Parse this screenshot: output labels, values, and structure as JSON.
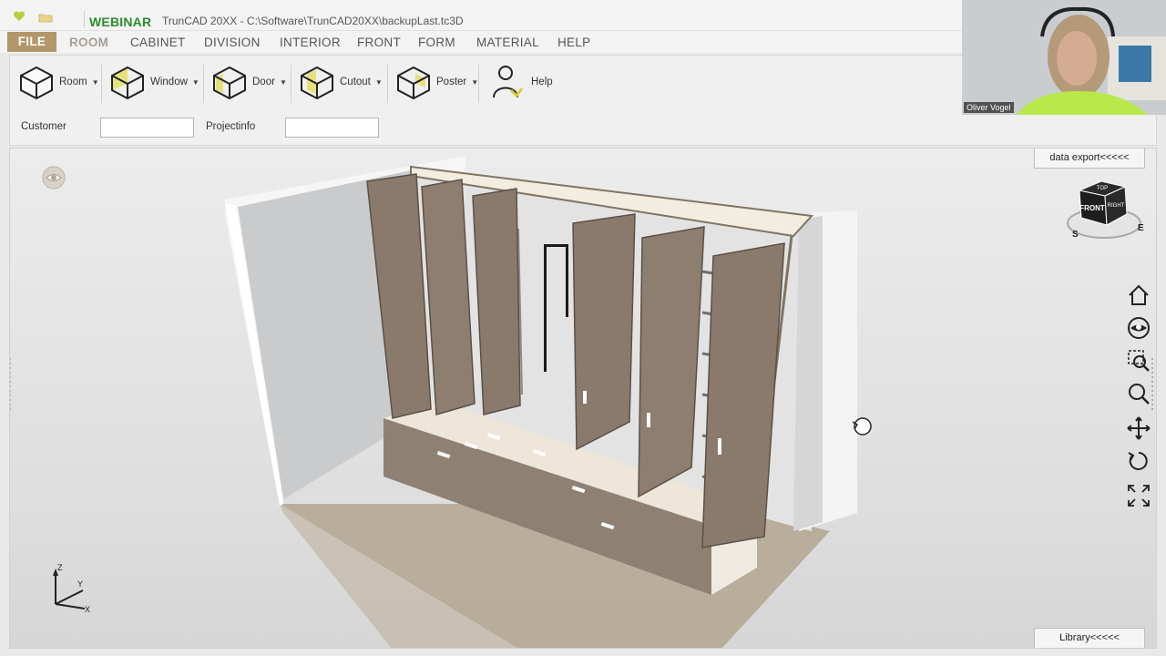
{
  "app": {
    "brand": "WEBINAR",
    "window_title": "TrunCAD 20XX - C:\\Software\\TrunCAD20XX\\backupLast.tc3D"
  },
  "menu": {
    "items": [
      "FILE",
      "ROOM",
      "CABINET",
      "DIVISION",
      "INTERIOR",
      "FRONT",
      "FORM",
      "MATERIAL",
      "HELP"
    ],
    "active": "ROOM"
  },
  "ribbon": {
    "buttons": [
      {
        "label": "Room",
        "icon": "room-icon",
        "dropdown": true
      },
      {
        "label": "Window",
        "icon": "window-icon",
        "dropdown": true
      },
      {
        "label": "Door",
        "icon": "door-icon",
        "dropdown": true
      },
      {
        "label": "Cutout",
        "icon": "cutout-icon",
        "dropdown": true
      },
      {
        "label": "Poster",
        "icon": "poster-icon",
        "dropdown": true
      },
      {
        "label": "Help",
        "icon": "help-person-icon",
        "dropdown": false
      }
    ],
    "fields": {
      "customer_label": "Customer",
      "customer_value": "",
      "projectinfo_label": "Projectinfo",
      "projectinfo_value": ""
    }
  },
  "viewport": {
    "data_export_label": "data export<<<<<",
    "library_label": "Library<<<<<",
    "navcube": {
      "face_top": "TOP",
      "face_front": "FRONT",
      "face_right": "RIGHT",
      "compass_s": "S",
      "compass_e": "E"
    },
    "axes": {
      "z": "Z",
      "y": "Y",
      "x": "X"
    },
    "tools": [
      "home-icon",
      "eye-view-icon",
      "zoom-window-icon",
      "zoom-icon",
      "pan-icon",
      "rotate-icon",
      "fit-screen-icon"
    ]
  },
  "webcam": {
    "participant_name": "Oliver Vogel"
  },
  "colors": {
    "accent_file": "#b29769",
    "brand_green": "#2e8b2e",
    "wood": "#8a7a6c",
    "floor": "#b3a58f"
  }
}
